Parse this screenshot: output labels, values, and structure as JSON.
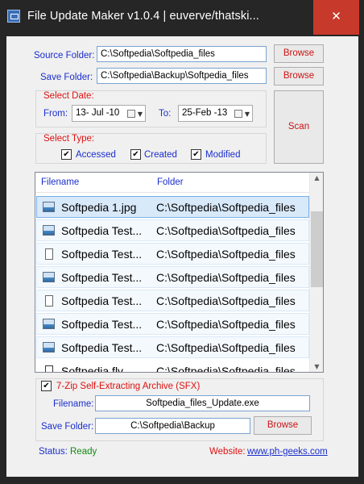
{
  "window": {
    "title": "File Update Maker v1.0.4 | euverve/thatski...",
    "close_glyph": "✕"
  },
  "source": {
    "label": "Source Folder:",
    "value": "C:\\Softpedia\\Softpedia_files",
    "browse_label": "Browse"
  },
  "save": {
    "label": "Save Folder:",
    "value": "C:\\Softpedia\\Backup\\Softpedia_files",
    "browse_label": "Browse"
  },
  "select_date": {
    "title": "Select Date:",
    "from_label": "From:",
    "from_value": "13- Jul -10",
    "to_label": "To:",
    "to_value": "25-Feb -13"
  },
  "scan_label": "Scan",
  "select_type": {
    "title": "Select Type:",
    "options": [
      {
        "label": "Accessed",
        "checked": true
      },
      {
        "label": "Created",
        "checked": true
      },
      {
        "label": "Modified",
        "checked": true
      }
    ]
  },
  "file_list": {
    "columns": [
      "Filename",
      "Folder"
    ],
    "rows": [
      {
        "filename": "Softpedia 1.jpg",
        "folder": "C:\\Softpedia\\Softpedia_files",
        "icon": "image-file-icon",
        "selected": true
      },
      {
        "filename": "Softpedia Test...",
        "folder": "C:\\Softpedia\\Softpedia_files",
        "icon": "image-file-icon",
        "selected": false
      },
      {
        "filename": "Softpedia Test...",
        "folder": "C:\\Softpedia\\Softpedia_files",
        "icon": "document-file-icon",
        "selected": false
      },
      {
        "filename": "Softpedia Test...",
        "folder": "C:\\Softpedia\\Softpedia_files",
        "icon": "image-file-icon",
        "selected": false
      },
      {
        "filename": "Softpedia Test...",
        "folder": "C:\\Softpedia\\Softpedia_files",
        "icon": "document-file-icon",
        "selected": false
      },
      {
        "filename": "Softpedia Test...",
        "folder": "C:\\Softpedia\\Softpedia_files",
        "icon": "image-file-icon",
        "selected": false
      },
      {
        "filename": "Softpedia Test...",
        "folder": "C:\\Softpedia\\Softpedia_files",
        "icon": "image-file-icon",
        "selected": false
      },
      {
        "filename": "Softpedia.flv",
        "folder": "C:\\Softpedia\\Softpedia_files",
        "icon": "blank-file-icon",
        "selected": false
      }
    ]
  },
  "sfx": {
    "checkbox_label": "7-Zip Self-Extracting Archive (SFX)",
    "checked": true,
    "filename_label": "Filename:",
    "filename_value": "Softpedia_files_Update.exe",
    "save_folder_label": "Save Folder:",
    "save_folder_value": "C:\\Softpedia\\Backup",
    "browse_label": "Browse"
  },
  "status": {
    "label": "Status:",
    "value": "Ready",
    "website_label": "Website:",
    "website_url": "www.ph-geeks.com"
  },
  "colors": {
    "label_blue": "#1a2ecc",
    "label_red": "#dd1111",
    "status_green": "#128a12",
    "close_red": "#c7392a"
  }
}
